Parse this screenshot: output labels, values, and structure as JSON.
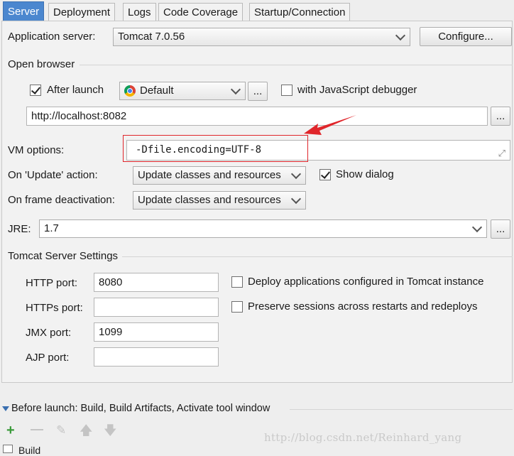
{
  "tabs": [
    {
      "label": "Server",
      "active": true
    },
    {
      "label": "Deployment",
      "active": false
    },
    {
      "label": "Logs",
      "active": false
    },
    {
      "label": "Code Coverage",
      "active": false
    },
    {
      "label": "Startup/Connection",
      "active": false
    }
  ],
  "server": {
    "app_server_label": "Application server:",
    "app_server_value": "Tomcat 7.0.56",
    "configure_label": "Configure..."
  },
  "browser": {
    "section_label": "Open browser",
    "after_launch_label": "After launch",
    "after_launch_checked": true,
    "browser_value": "Default",
    "ellipsis": "...",
    "js_debugger_label": "with JavaScript debugger",
    "js_debugger_checked": false,
    "url_value": "http://localhost:8082",
    "url_ellipsis": "..."
  },
  "vm": {
    "label": "VM options:",
    "value": "-Dfile.encoding=UTF-8"
  },
  "update": {
    "label": "On 'Update' action:",
    "value": "Update classes and resources",
    "show_dialog_label": "Show dialog",
    "show_dialog_checked": true
  },
  "frame": {
    "label": "On frame deactivation:",
    "value": "Update classes and resources"
  },
  "jre": {
    "label": "JRE:",
    "value": "1.7",
    "ellipsis": "..."
  },
  "tomcat": {
    "section_label": "Tomcat Server Settings",
    "http_label": "HTTP port:",
    "http_value": "8080",
    "https_label": "HTTPs port:",
    "https_value": "",
    "jmx_label": "JMX port:",
    "jmx_value": "1099",
    "ajp_label": "AJP port:",
    "ajp_value": "",
    "deploy_label": "Deploy applications configured in Tomcat instance",
    "deploy_checked": false,
    "preserve_label": "Preserve sessions across restarts and redeploys",
    "preserve_checked": false
  },
  "before_launch": {
    "label": "Before launch: Build, Build Artifacts, Activate tool window",
    "first_item": "Build"
  },
  "watermark": "http://blog.csdn.net/Reinhard_yang",
  "colors": {
    "active_tab": "#4b87cf",
    "annotation": "#e0262b",
    "add_icon": "#3a9a3a"
  }
}
